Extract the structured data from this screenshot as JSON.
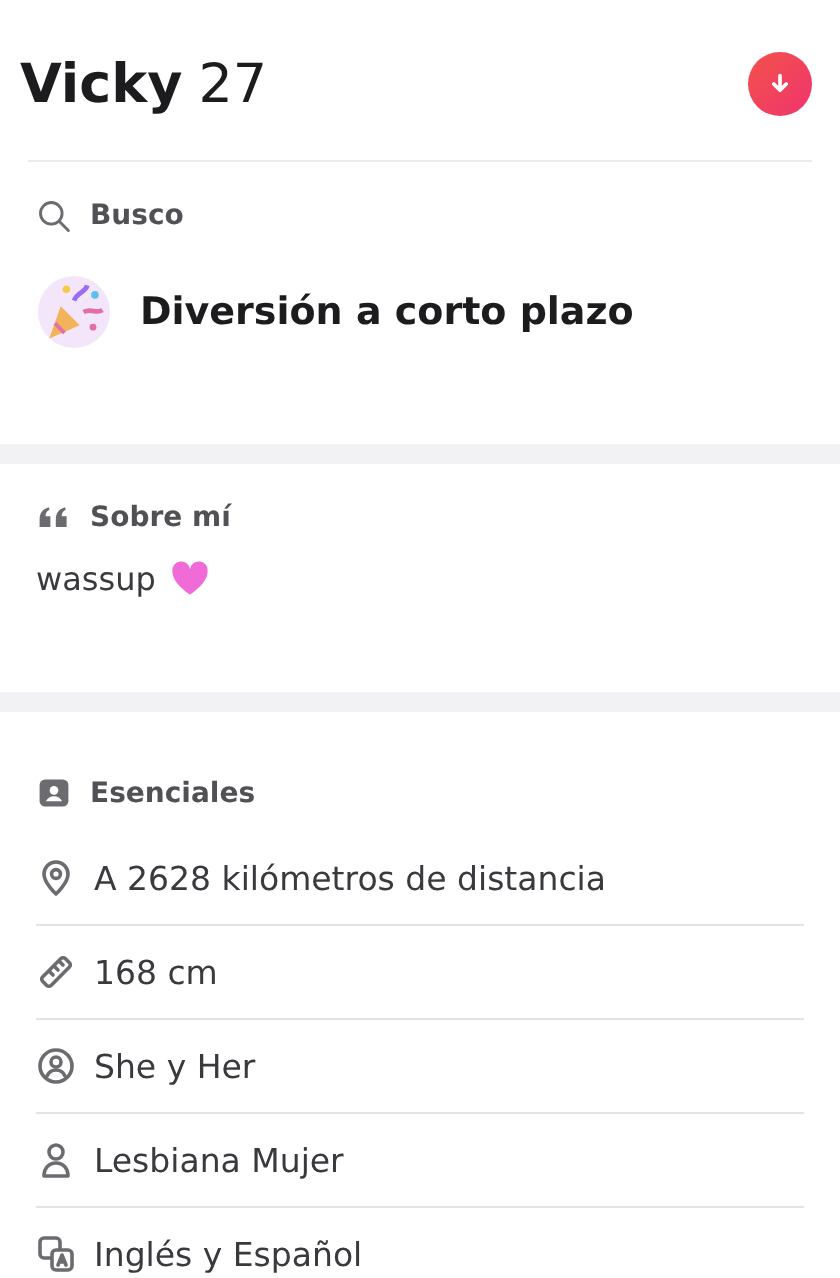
{
  "header": {
    "name": "Vicky",
    "age": "27"
  },
  "looking_for": {
    "label": "Busco",
    "value": "Diversión a corto plazo"
  },
  "about": {
    "label": "Sobre mí",
    "text": "wassup"
  },
  "essentials": {
    "label": "Esenciales",
    "items": [
      {
        "kind": "location",
        "text": "A 2628 kilómetros de distancia"
      },
      {
        "kind": "height",
        "text": "168 cm"
      },
      {
        "kind": "pronouns",
        "text": "She y Her"
      },
      {
        "kind": "orientation",
        "text": "Lesbiana Mujer"
      },
      {
        "kind": "languages",
        "text": "Inglés y Español"
      }
    ]
  }
}
